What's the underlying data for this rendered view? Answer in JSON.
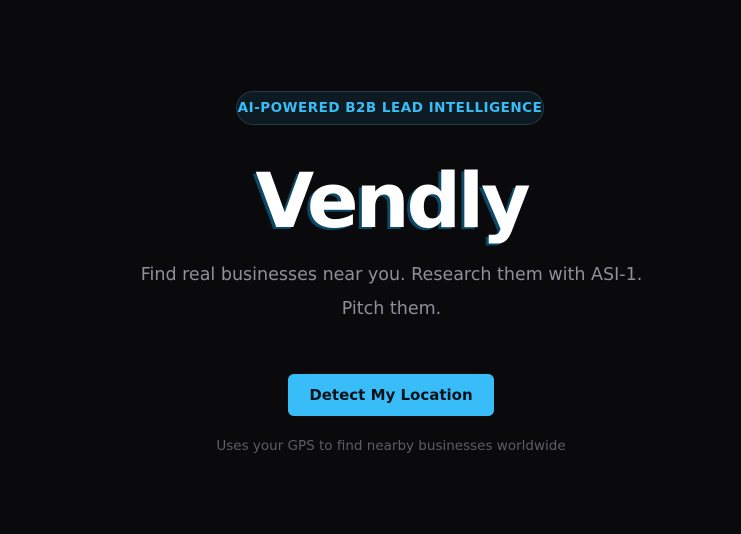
{
  "hero": {
    "badge": "AI-POWERED B2B LEAD INTELLIGENCE",
    "title": "Vendly",
    "subtitle": "Find real businesses near you. Research them with ASI-1. Pitch them."
  },
  "cta": {
    "label": "Detect My Location",
    "helper": "Uses your GPS to find nearby businesses worldwide"
  },
  "colors": {
    "background": "#0a0a0c",
    "accent": "#38bdf8",
    "title": "#ffffff",
    "muted_text": "#8e8f99"
  }
}
